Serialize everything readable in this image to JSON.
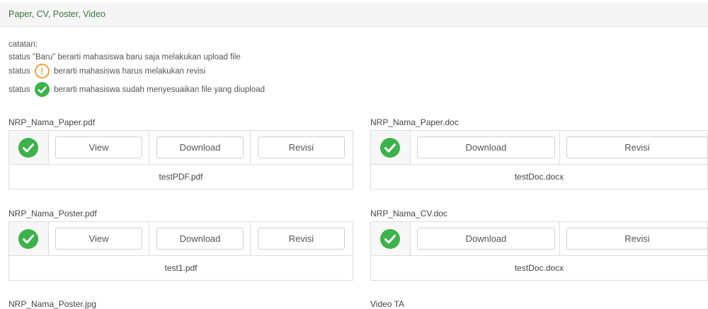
{
  "panel": {
    "title": "Paper, CV, Poster, Video"
  },
  "notes": {
    "heading": "catatan:",
    "line1": "status \"Baru\" berarti mahasiswa baru saja melakukan upload file",
    "line2_prefix": "status",
    "line2_suffix": "berarti mahasiswa harus melakukan revisi",
    "line3_prefix": "status",
    "line3_suffix": "berarti mahasiswa sudah menyesuaikan file yang diupload"
  },
  "uploads": {
    "paper_pdf": {
      "label": "NRP_Nama_Paper.pdf",
      "view": "View",
      "download": "Download",
      "revisi": "Revisi",
      "filename": "testPDF.pdf"
    },
    "paper_doc": {
      "label": "NRP_Nama_Paper.doc",
      "download": "Download",
      "revisi": "Revisi",
      "filename": "testDoc.docx"
    },
    "poster_pdf": {
      "label": "NRP_Nama_Poster.pdf",
      "view": "View",
      "download": "Download",
      "revisi": "Revisi",
      "filename": "test1.pdf"
    },
    "cv_doc": {
      "label": "NRP_Nama_CV.doc",
      "download": "Download",
      "revisi": "Revisi",
      "filename": "testDoc.docx"
    },
    "poster_jpg": {
      "label": "NRP_Nama_Poster.jpg"
    },
    "video": {
      "label": "Video TA"
    }
  },
  "icons": {
    "warn": "exclamation-circle-icon",
    "ok": "check-circle-icon"
  },
  "colors": {
    "ok": "#3cb24a",
    "warn": "#eea236",
    "title": "#3c763d"
  }
}
